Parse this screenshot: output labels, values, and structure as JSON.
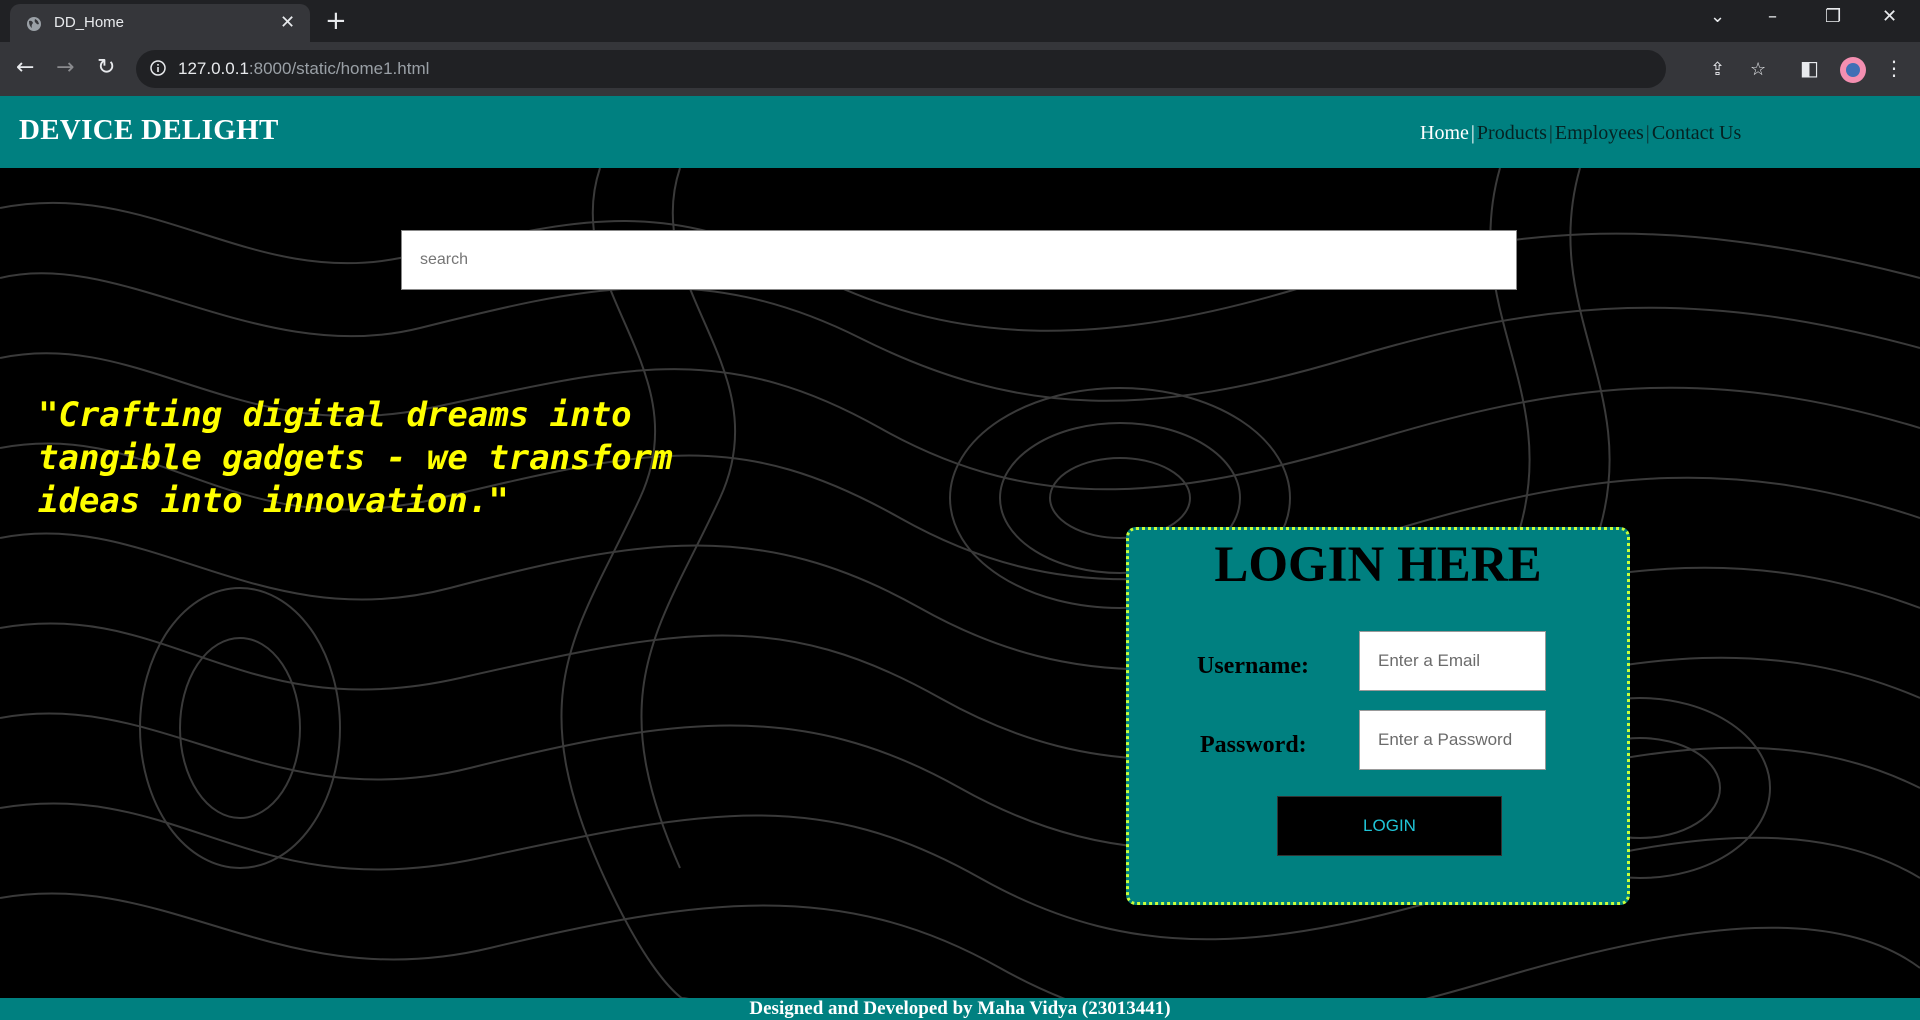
{
  "browser": {
    "tab_title": "DD_Home",
    "tab_close": "✕",
    "new_tab": "+",
    "url_host": "127.0.0.1",
    "url_path": ":8000/static/home1.html"
  },
  "header": {
    "logo": "DEVICE DELIGHT",
    "nav": {
      "home": "Home",
      "products": "Products",
      "employees": "Employees",
      "contact": "Contact Us",
      "separator": "|"
    }
  },
  "search": {
    "placeholder": "search"
  },
  "quote": "\"Crafting digital dreams into tangible gadgets - we transform ideas into innovation.\"",
  "login": {
    "title": "LOGIN HERE",
    "username_label": "Username:",
    "username_placeholder": "Enter a Email",
    "password_label": "Password:",
    "password_placeholder": "Enter a Password",
    "button": "LOGIN"
  },
  "footer": "Designed and Developed by Maha Vidya (23013441)",
  "colors": {
    "header_bg": "#008080",
    "quote": "#ffff00",
    "login_border": "#c8ff3a",
    "login_button_text": "#20c5d8"
  }
}
